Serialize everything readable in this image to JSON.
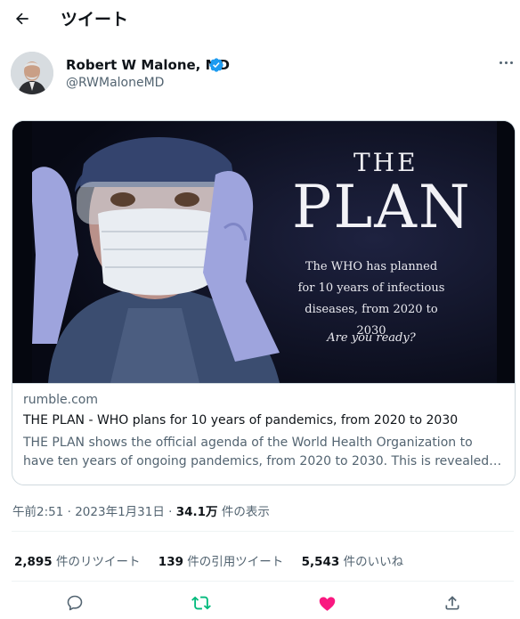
{
  "header": {
    "title": "ツイート",
    "back_icon": "arrow-left-icon"
  },
  "author": {
    "name": "Robert W Malone, MD",
    "handle": "@RWMaloneMD",
    "verified_color": "#1d9bf0"
  },
  "card": {
    "poster": {
      "the": "THE",
      "plan": "PLAN",
      "description": "The WHO has planned for 10 years of infectious diseases, from 2020 to 2030",
      "tagline": "Are you ready?"
    },
    "domain": "rumble.com",
    "title": "THE PLAN - WHO plans for 10 years of pandemics, from 2020 to 2030",
    "description": "THE PLAN shows the official agenda of the World Health Organization to have ten years of ongoing pandemics, from 2020 to 2030. This is revealed by a WHO ..."
  },
  "meta": {
    "time": "午前2:51",
    "date": "2023年1月31日",
    "views": "34.1万",
    "views_label": "件の表示",
    "separator": "·"
  },
  "stats": {
    "retweets": "2,895",
    "retweets_label": "件のリツイート",
    "quotes": "139",
    "quotes_label": "件の引用ツイート",
    "likes": "5,543",
    "likes_label": "件のいいね"
  },
  "colors": {
    "retweet": "#00ba7c",
    "like": "#f91880",
    "muted": "#536471"
  }
}
